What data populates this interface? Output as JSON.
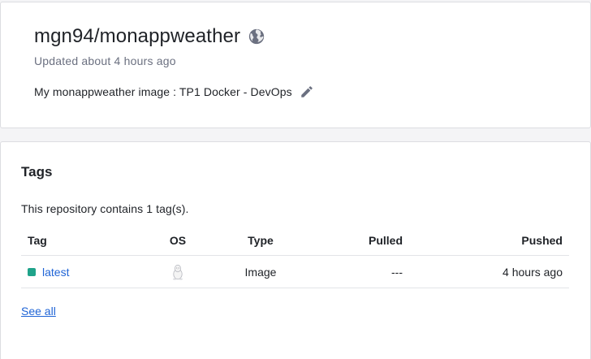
{
  "repo": {
    "title": "mgn94/monappweather",
    "updated": "Updated about 4 hours ago",
    "description": "My monappweather image : TP1 Docker - DevOps",
    "visibility_icon": "globe-icon",
    "edit_icon": "pencil-icon"
  },
  "tags": {
    "heading": "Tags",
    "count_text": "This repository contains 1 tag(s).",
    "columns": [
      "Tag",
      "OS",
      "Type",
      "Pulled",
      "Pushed"
    ],
    "rows": [
      {
        "tag": "latest",
        "status_color": "#1fa38a",
        "os_icon": "linux-icon",
        "type": "Image",
        "pulled": "---",
        "pushed": "4 hours ago"
      }
    ],
    "see_all": "See all"
  },
  "colors": {
    "link": "#1f64d6",
    "muted_text": "#6b7080",
    "status_active": "#1fa38a"
  }
}
